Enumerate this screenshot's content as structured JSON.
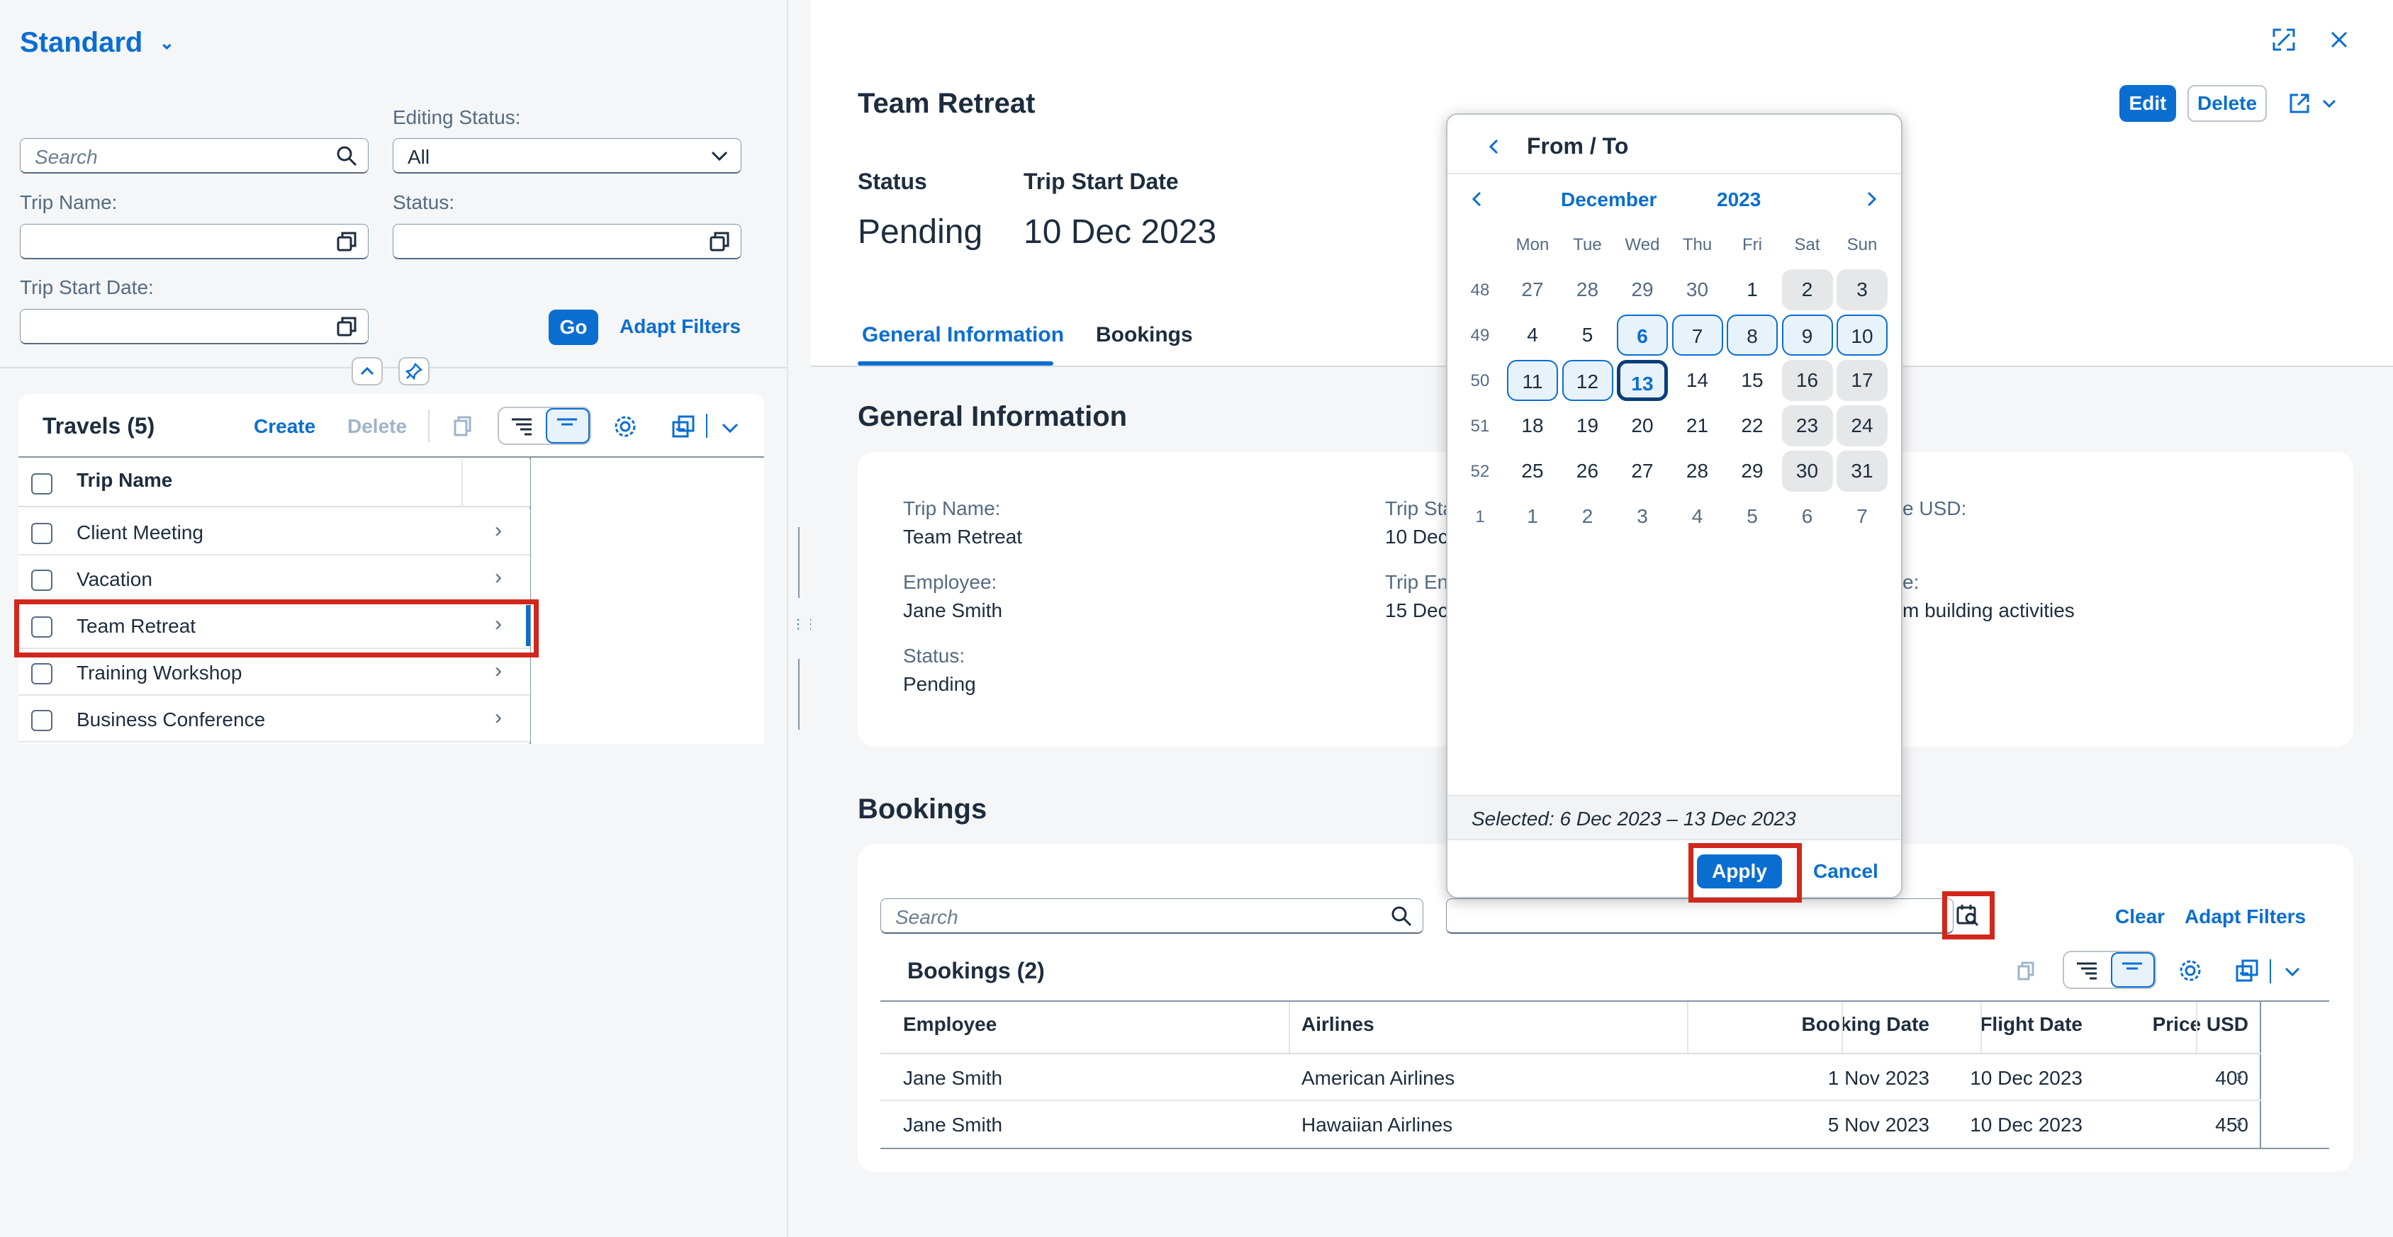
{
  "variant": {
    "title": "Standard"
  },
  "filters": {
    "search_placeholder": "Search",
    "editing_status_label": "Editing Status:",
    "editing_status_value": "All",
    "trip_name_label": "Trip Name:",
    "status_label": "Status:",
    "trip_start_date_label": "Trip Start Date:",
    "go_label": "Go",
    "adapt_filters_label": "Adapt Filters"
  },
  "travels": {
    "title": "Travels (5)",
    "create_label": "Create",
    "delete_label": "Delete",
    "column_header": "Trip Name",
    "rows": [
      "Client Meeting",
      "Vacation",
      "Team Retreat",
      "Training Workshop",
      "Business Conference"
    ]
  },
  "detail": {
    "title": "Team Retreat",
    "edit_label": "Edit",
    "delete_label": "Delete",
    "status_header": "Status",
    "status_value": "Pending",
    "start_header": "Trip Start Date",
    "start_value": "10 Dec 2023",
    "tabs": [
      "General Information",
      "Bookings"
    ],
    "general_title": "General Information",
    "fields": {
      "trip_name_label": "Trip Name:",
      "trip_name_value": "Team Retreat",
      "employee_label": "Employee:",
      "employee_value": "Jane Smith",
      "status_label": "Status:",
      "status_value": "Pending",
      "trip_start_label_partial": "Trip Sta",
      "trip_start_value_partial": "10 Dec",
      "trip_end_label_partial": "Trip En",
      "trip_end_value_partial": "15 Dec",
      "price_label_partial": "e USD:",
      "desc_label_partial": "e:",
      "desc_value_partial": "m building activities"
    }
  },
  "bookings": {
    "section_title": "Bookings",
    "search_placeholder": "Search",
    "clear_label": "Clear",
    "adapt_filters_label": "Adapt Filters",
    "table_title": "Bookings (2)",
    "columns": [
      "Employee",
      "Airlines",
      "Booking Date",
      "Flight Date",
      "Price USD"
    ],
    "rows": [
      [
        "Jane Smith",
        "American Airlines",
        "1 Nov 2023",
        "10 Dec 2023",
        "400"
      ],
      [
        "Jane Smith",
        "Hawaiian Airlines",
        "5 Nov 2023",
        "10 Dec 2023",
        "450"
      ]
    ]
  },
  "calendar": {
    "title": "From / To",
    "month": "December",
    "year": "2023",
    "weekdays": [
      "Mon",
      "Tue",
      "Wed",
      "Thu",
      "Fri",
      "Sat",
      "Sun"
    ],
    "weeks": [
      {
        "wk": "48",
        "days": [
          "27",
          "28",
          "29",
          "30",
          "1",
          "2",
          "3"
        ]
      },
      {
        "wk": "49",
        "days": [
          "4",
          "5",
          "6",
          "7",
          "8",
          "9",
          "10"
        ]
      },
      {
        "wk": "50",
        "days": [
          "11",
          "12",
          "13",
          "14",
          "15",
          "16",
          "17"
        ]
      },
      {
        "wk": "51",
        "days": [
          "18",
          "19",
          "20",
          "21",
          "22",
          "23",
          "24"
        ]
      },
      {
        "wk": "52",
        "days": [
          "25",
          "26",
          "27",
          "28",
          "29",
          "30",
          "31"
        ]
      },
      {
        "wk": "1",
        "days": [
          "1",
          "2",
          "3",
          "4",
          "5",
          "6",
          "7"
        ]
      }
    ],
    "selected_text": "Selected: 6 Dec 2023 – 13 Dec 2023",
    "apply_label": "Apply",
    "cancel_label": "Cancel"
  }
}
